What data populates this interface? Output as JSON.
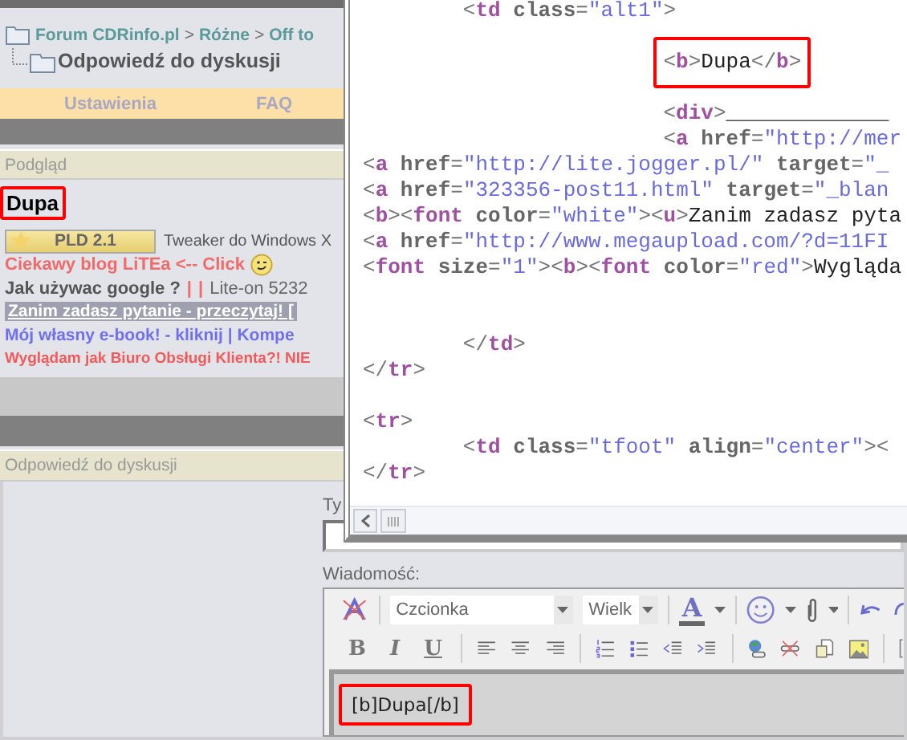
{
  "breadcrumb": {
    "items": [
      "Forum CDRinfo.pl",
      "Różne",
      "Off to"
    ],
    "separator": ">"
  },
  "page_title": "Odpowiedź do dyskusji",
  "nav": [
    "Ustawienia",
    "FAQ"
  ],
  "preview": {
    "header": "Podgląd",
    "text": "Dupa",
    "highlighted": true
  },
  "signature": {
    "banner": "PLD 2.1",
    "caption": "Tweaker do Windows X",
    "lines": [
      {
        "segments": [
          {
            "kind": "red-link",
            "text": "Ciekawy blog LiTEa <-- Click"
          },
          {
            "kind": "smiley"
          }
        ]
      },
      {
        "segments": [
          {
            "kind": "grey-bold",
            "text": "Jak używac google ?"
          },
          {
            "kind": "bar",
            "text": "|"
          },
          {
            "kind": "bar",
            "text": "|"
          },
          {
            "kind": "grey",
            "text": "Lite-on 5232"
          }
        ]
      },
      {
        "segments": [
          {
            "kind": "white-underline",
            "text": "Zanim zadasz pytanie - przeczytaj! ["
          }
        ]
      },
      {
        "segments": [
          {
            "kind": "blue-link",
            "text": "Mój własny e-book! - kliknij | Kompe"
          }
        ]
      },
      {
        "segments": [
          {
            "kind": "red-small",
            "text": "Wyglądam jak Biuro Obsługi Klienta?! NIE"
          }
        ]
      }
    ]
  },
  "reply": {
    "header": "Odpowiedź do dyskusji",
    "title_label": "Ty",
    "message_label": "Wiadomość:",
    "font_select": "Czcionka",
    "size_select": "Wielk",
    "color_button": "A",
    "format_buttons": [
      "B",
      "I",
      "U"
    ],
    "message": {
      "text": "[b]Dupa[/b]",
      "highlighted": true
    }
  },
  "source_window": {
    "lines": [
      {
        "kind": "code",
        "highlighted": false,
        "tokens": [
          {
            "kind": "p",
            "text": "        <"
          },
          {
            "kind": "tag",
            "text": "td"
          },
          {
            "kind": "attr",
            "text": " class"
          },
          {
            "kind": "p",
            "text": "="
          },
          {
            "kind": "val",
            "text": "\"alt1\""
          },
          {
            "kind": "p",
            "text": ">"
          }
        ]
      },
      {
        "kind": "blank"
      },
      {
        "kind": "code",
        "highlighted": true,
        "tokens": [
          {
            "kind": "p",
            "text": "                        <"
          },
          {
            "kind": "tag",
            "text": "b"
          },
          {
            "kind": "p",
            "text": ">"
          },
          {
            "kind": "txt",
            "text": "Dupa"
          },
          {
            "kind": "p",
            "text": "</"
          },
          {
            "kind": "tag",
            "text": "b"
          },
          {
            "kind": "p",
            "text": ">"
          }
        ]
      },
      {
        "kind": "blank"
      },
      {
        "kind": "code",
        "highlighted": false,
        "tokens": [
          {
            "kind": "p",
            "text": "                        <"
          },
          {
            "kind": "tag",
            "text": "div"
          },
          {
            "kind": "p",
            "text": ">"
          },
          {
            "kind": "txt",
            "text": "_____________"
          }
        ]
      },
      {
        "kind": "code",
        "highlighted": false,
        "tokens": [
          {
            "kind": "p",
            "text": "                        <"
          },
          {
            "kind": "tag",
            "text": "a"
          },
          {
            "kind": "attr",
            "text": " href"
          },
          {
            "kind": "p",
            "text": "="
          },
          {
            "kind": "val",
            "text": "\"http://mer"
          }
        ]
      },
      {
        "kind": "code",
        "highlighted": false,
        "tokens": [
          {
            "kind": "p",
            "text": "<"
          },
          {
            "kind": "tag",
            "text": "a"
          },
          {
            "kind": "attr",
            "text": " href"
          },
          {
            "kind": "p",
            "text": "="
          },
          {
            "kind": "val",
            "text": "\"http://lite.jogger.pl/\""
          },
          {
            "kind": "attr",
            "text": " target"
          },
          {
            "kind": "p",
            "text": "="
          },
          {
            "kind": "val",
            "text": "\"_"
          }
        ]
      },
      {
        "kind": "code",
        "highlighted": false,
        "tokens": [
          {
            "kind": "p",
            "text": "<"
          },
          {
            "kind": "tag",
            "text": "a"
          },
          {
            "kind": "attr",
            "text": " href"
          },
          {
            "kind": "p",
            "text": "="
          },
          {
            "kind": "val",
            "text": "\"323356-post11.html\""
          },
          {
            "kind": "attr",
            "text": " target"
          },
          {
            "kind": "p",
            "text": "="
          },
          {
            "kind": "val",
            "text": "\"_blan"
          }
        ]
      },
      {
        "kind": "code",
        "highlighted": false,
        "tokens": [
          {
            "kind": "p",
            "text": "<"
          },
          {
            "kind": "tag",
            "text": "b"
          },
          {
            "kind": "p",
            "text": "><"
          },
          {
            "kind": "tag",
            "text": "font"
          },
          {
            "kind": "attr",
            "text": " color"
          },
          {
            "kind": "p",
            "text": "="
          },
          {
            "kind": "val",
            "text": "\"white\""
          },
          {
            "kind": "p",
            "text": "><"
          },
          {
            "kind": "tag",
            "text": "u"
          },
          {
            "kind": "p",
            "text": ">"
          },
          {
            "kind": "txt",
            "text": "Zanim zadasz pyta"
          }
        ]
      },
      {
        "kind": "code",
        "highlighted": false,
        "tokens": [
          {
            "kind": "p",
            "text": "<"
          },
          {
            "kind": "tag",
            "text": "a"
          },
          {
            "kind": "attr",
            "text": " href"
          },
          {
            "kind": "p",
            "text": "="
          },
          {
            "kind": "val",
            "text": "\"http://www.megaupload.com/?d=11FI"
          }
        ]
      },
      {
        "kind": "code",
        "highlighted": false,
        "tokens": [
          {
            "kind": "p",
            "text": "<"
          },
          {
            "kind": "tag",
            "text": "font"
          },
          {
            "kind": "attr",
            "text": " size"
          },
          {
            "kind": "p",
            "text": "="
          },
          {
            "kind": "val",
            "text": "\"1\""
          },
          {
            "kind": "p",
            "text": "><"
          },
          {
            "kind": "tag",
            "text": "b"
          },
          {
            "kind": "p",
            "text": "><"
          },
          {
            "kind": "tag",
            "text": "font"
          },
          {
            "kind": "attr",
            "text": " color"
          },
          {
            "kind": "p",
            "text": "="
          },
          {
            "kind": "val",
            "text": "\"red\""
          },
          {
            "kind": "p",
            "text": ">"
          },
          {
            "kind": "txt",
            "text": "Wygląda"
          }
        ]
      },
      {
        "kind": "blank"
      },
      {
        "kind": "blank"
      },
      {
        "kind": "code",
        "highlighted": false,
        "tokens": [
          {
            "kind": "p",
            "text": "        </"
          },
          {
            "kind": "tag",
            "text": "td"
          },
          {
            "kind": "p",
            "text": ">"
          }
        ]
      },
      {
        "kind": "code",
        "highlighted": false,
        "tokens": [
          {
            "kind": "p",
            "text": "</"
          },
          {
            "kind": "tag",
            "text": "tr"
          },
          {
            "kind": "p",
            "text": ">"
          }
        ]
      },
      {
        "kind": "blank"
      },
      {
        "kind": "code",
        "highlighted": false,
        "tokens": [
          {
            "kind": "p",
            "text": "<"
          },
          {
            "kind": "tag",
            "text": "tr"
          },
          {
            "kind": "p",
            "text": ">"
          }
        ]
      },
      {
        "kind": "code",
        "highlighted": false,
        "tokens": [
          {
            "kind": "p",
            "text": "        <"
          },
          {
            "kind": "tag",
            "text": "td"
          },
          {
            "kind": "attr",
            "text": " class"
          },
          {
            "kind": "p",
            "text": "="
          },
          {
            "kind": "val",
            "text": "\"tfoot\""
          },
          {
            "kind": "attr",
            "text": " align"
          },
          {
            "kind": "p",
            "text": "="
          },
          {
            "kind": "val",
            "text": "\"center\""
          },
          {
            "kind": "p",
            "text": "><"
          }
        ]
      },
      {
        "kind": "code",
        "highlighted": false,
        "tokens": [
          {
            "kind": "p",
            "text": "</"
          },
          {
            "kind": "tag",
            "text": "tr"
          },
          {
            "kind": "p",
            "text": ">"
          }
        ]
      }
    ]
  }
}
